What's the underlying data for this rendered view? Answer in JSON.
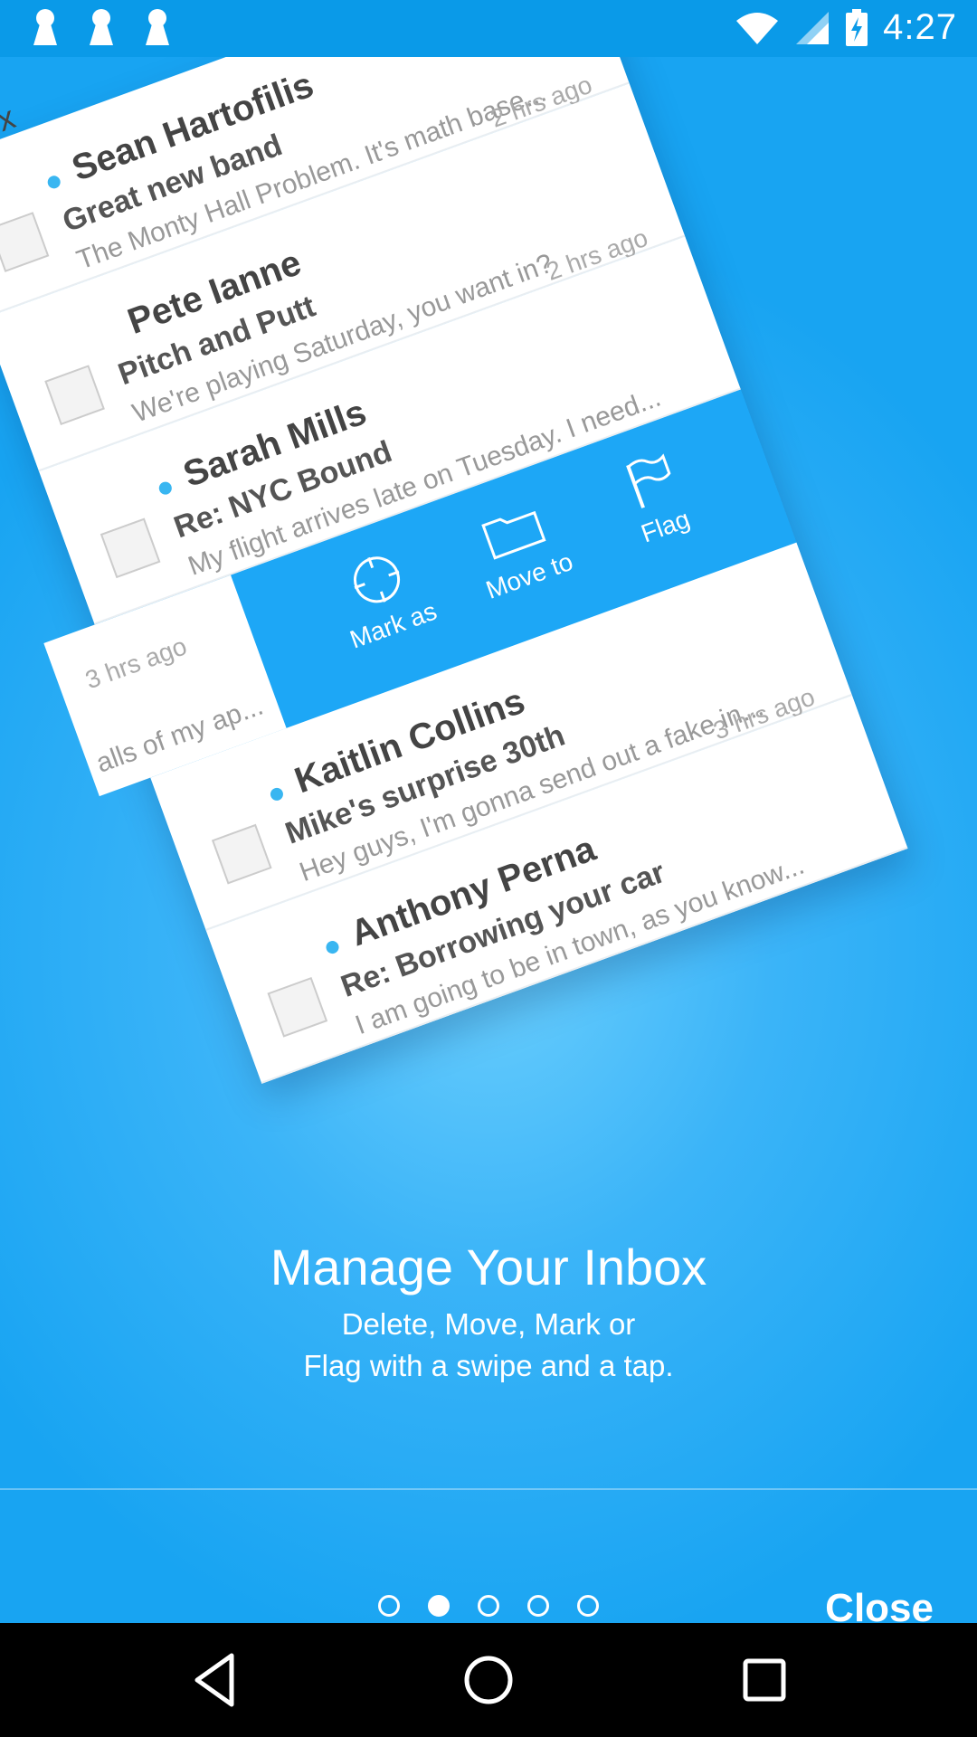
{
  "status_bar": {
    "time": "4:27",
    "icons": [
      "keyhole-icon",
      "keyhole-icon",
      "keyhole-icon",
      "wifi-icon",
      "cellular-signal-icon",
      "battery-charging-icon"
    ]
  },
  "inbox": {
    "label": "Inbox",
    "emails": [
      {
        "sender": "Sean Hartofilis",
        "subject": "Great new band",
        "preview": "The Monty Hall Problem. It's math base...",
        "time": "2 hrs ago",
        "unread": true
      },
      {
        "sender": "Pete Ianne",
        "subject": "Pitch and Putt",
        "preview": "We're playing Saturday, you want in?",
        "time": "2 hrs ago",
        "unread": false
      },
      {
        "sender": "Sarah Mills",
        "subject": "Re: NYC Bound",
        "preview": "My flight arrives late on Tuesday. I need...",
        "time": "3 hrs ago",
        "unread": true
      },
      {
        "sender": "Kaitlin Collins",
        "subject": "Mike's surprise 30th",
        "preview": "Hey guys, I'm gonna send out a fake in...",
        "time": "3 hrs ago",
        "unread": true
      },
      {
        "sender": "Anthony Perna",
        "subject": "Re: Borrowing your car",
        "preview": "I am going to be in town, as you know...",
        "time": "",
        "unread": true
      }
    ],
    "swiped_fragment": {
      "time": "3 hrs ago",
      "preview": "alls of my ap..."
    },
    "actions": [
      {
        "label": "Mark as",
        "icon": "crosshair-icon"
      },
      {
        "label": "Move to",
        "icon": "folder-icon"
      },
      {
        "label": "Flag",
        "icon": "flag-icon"
      }
    ]
  },
  "onboarding": {
    "title": "Manage Your Inbox",
    "line1": "Delete, Move, Mark or",
    "line2": "Flag with a swipe and a tap.",
    "page_count": 5,
    "active_page": 2,
    "close_label": "Close"
  },
  "nav": {
    "back": "back-icon",
    "home": "home-icon",
    "recents": "recents-icon"
  },
  "colors": {
    "status_bar": "#0a9ae8",
    "accent": "#1da7f6",
    "unread_dot": "#39b6f1"
  }
}
